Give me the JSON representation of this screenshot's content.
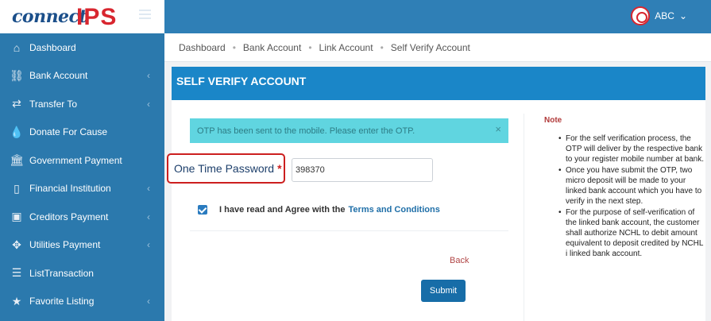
{
  "brand": {
    "connect": "connect",
    "ips": "IPS"
  },
  "user": {
    "name": "ABC",
    "caret": "⌄"
  },
  "sidebar": {
    "items": [
      {
        "label": "Dashboard",
        "icon": "home-icon",
        "glyph": "⌂",
        "chevron": ""
      },
      {
        "label": "Bank Account",
        "icon": "link-icon",
        "glyph": "⛓",
        "chevron": "‹"
      },
      {
        "label": "Transfer To",
        "icon": "transfer-icon",
        "glyph": "⇄",
        "chevron": "‹"
      },
      {
        "label": "Donate For Cause",
        "icon": "drop-icon",
        "glyph": "💧",
        "chevron": ""
      },
      {
        "label": "Government Payment",
        "icon": "bank-building-icon",
        "glyph": "🏛",
        "chevron": ""
      },
      {
        "label": "Financial Institution",
        "icon": "chart-icon",
        "glyph": "▯",
        "chevron": "‹"
      },
      {
        "label": "Creditors Payment",
        "icon": "money-icon",
        "glyph": "▣",
        "chevron": "‹"
      },
      {
        "label": "Utilities Payment",
        "icon": "move-icon",
        "glyph": "✥",
        "chevron": "‹"
      },
      {
        "label": "ListTransaction",
        "icon": "list-icon",
        "glyph": "☰",
        "chevron": ""
      },
      {
        "label": "Favorite Listing",
        "icon": "star-icon",
        "glyph": "★",
        "chevron": "‹"
      }
    ]
  },
  "breadcrumb": [
    "Dashboard",
    "Bank Account",
    "Link Account",
    "Self Verify Account"
  ],
  "card": {
    "title": "SELF VERIFY ACCOUNT"
  },
  "alert": {
    "text": "OTP has been sent to the mobile. Please enter the OTP.",
    "close": "×"
  },
  "form": {
    "otp_label": "One Time Password",
    "required_mark": "*",
    "otp_value": "398370",
    "agree_text": "I have read and Agree with the",
    "agree_link": "Terms and Conditions",
    "back_label": "Back",
    "submit_label": "Submit"
  },
  "note": {
    "title": "Note",
    "items": [
      "For the self verification process, the OTP will deliver by the respective bank to your register mobile number at bank.",
      "Once you have submit the OTP, two micro deposit will be made to your linked bank account which you have to verify in the next step.",
      "For the purpose of self-verification of the linked bank account, the customer shall authorize NCHL to debit amount equivalent to deposit credited by NCHL i linked bank account."
    ]
  }
}
